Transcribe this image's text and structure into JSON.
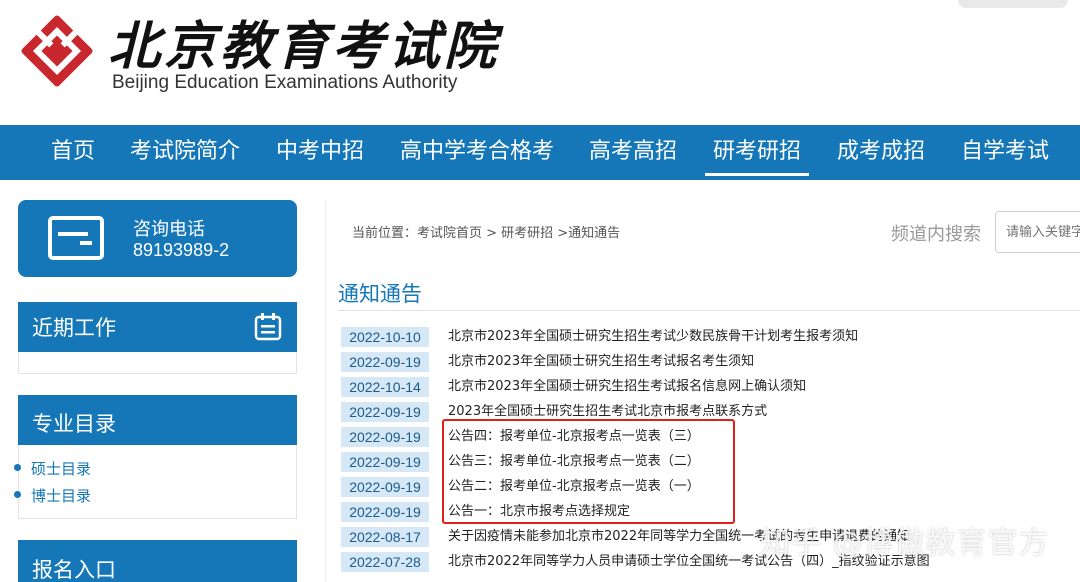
{
  "header": {
    "logo_cn": "北京教育考试院",
    "logo_en": "Beijing Education Examinations Authority"
  },
  "nav": {
    "items": [
      {
        "label": "首页"
      },
      {
        "label": "考试院简介"
      },
      {
        "label": "中考中招"
      },
      {
        "label": "高中学考合格考"
      },
      {
        "label": "高考高招"
      },
      {
        "label": "研考研招"
      },
      {
        "label": "成考成招"
      },
      {
        "label": "自学考试"
      }
    ],
    "active": "研考研招"
  },
  "sidebar": {
    "hotline": {
      "title": "咨询电话",
      "phone": "89193989-2",
      "icon": "id-card-icon"
    },
    "recent_work": {
      "title": "近期工作",
      "icon": "calendar-icon"
    },
    "catalog": {
      "title": "专业目录",
      "items": [
        {
          "label": "硕士目录"
        },
        {
          "label": "博士目录"
        }
      ]
    },
    "signup": {
      "title": "报名入口"
    }
  },
  "main": {
    "breadcrumb": "当前位置：考试院首页 > 研考研招 >通知通告",
    "search": {
      "label": "频道内搜索",
      "placeholder": "请输入关键字"
    },
    "section_title": "通知通告",
    "rows": [
      {
        "date": "2022-10-10",
        "title": "北京市2023年全国硕士研究生招生考试少数民族骨干计划考生报考须知"
      },
      {
        "date": "2022-09-19",
        "title": "北京市2023年全国硕士研究生招生考试报名考生须知"
      },
      {
        "date": "2022-10-14",
        "title": "北京市2023年全国硕士研究生招生考试报名信息网上确认须知"
      },
      {
        "date": "2022-09-19",
        "title": "2023年全国硕士研究生招生考试北京市报考点联系方式"
      },
      {
        "date": "2022-09-19",
        "title": "公告四：报考单位-北京报考点一览表（三）"
      },
      {
        "date": "2022-09-19",
        "title": "公告三：报考单位-北京报考点一览表（二）"
      },
      {
        "date": "2022-09-19",
        "title": "公告二：报考单位-北京报考点一览表（一）"
      },
      {
        "date": "2022-09-19",
        "title": "公告一：北京市报考点选择规定"
      },
      {
        "date": "2022-08-17",
        "title": "关于因疫情未能参加北京市2022年同等学力全国统一考试的考生申请退费的通知"
      },
      {
        "date": "2022-07-28",
        "title": "北京市2022年同等学力人员申请硕士学位全国统一考试公告（四）_指纹验证示意图"
      }
    ],
    "highlight_color": "#e0211b"
  },
  "watermark": "知乎 @博傲教育官方",
  "colors": {
    "brand": "#1577b8",
    "logo_red": "#c8282d",
    "date_bg": "#d6e7f5"
  }
}
